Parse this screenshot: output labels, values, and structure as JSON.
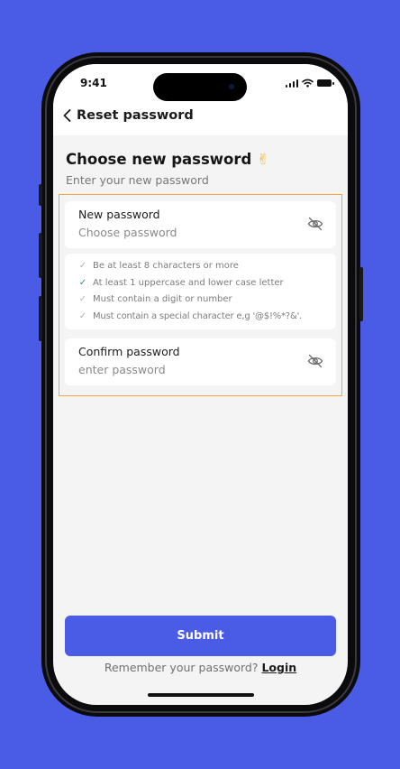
{
  "status_bar": {
    "time": "9:41"
  },
  "nav": {
    "title": "Reset password"
  },
  "heading": {
    "title": "Choose new password",
    "emoji": "✌",
    "subtitle": "Enter your new password"
  },
  "new_password": {
    "label": "New password",
    "placeholder": "Choose password"
  },
  "rules": [
    {
      "text": "Be at least 8 characters or more",
      "met": false
    },
    {
      "text": "At least 1 uppercase and lower case letter",
      "met": true
    },
    {
      "text": "Must contain a digit or number",
      "met": false
    },
    {
      "text": "Must contain a special character e,g '@$!%*?&'.",
      "met": false
    }
  ],
  "confirm_password": {
    "label": "Confirm password",
    "placeholder": "enter password"
  },
  "submit": {
    "label": "Submit"
  },
  "footer": {
    "prompt": "Remember your password?",
    "link": "Login"
  },
  "colors": {
    "accent": "#4A5BE6",
    "highlight_border": "#F5A640",
    "rule_met": "#1E9E6A",
    "rule_unmet": "#B5B5B5"
  }
}
